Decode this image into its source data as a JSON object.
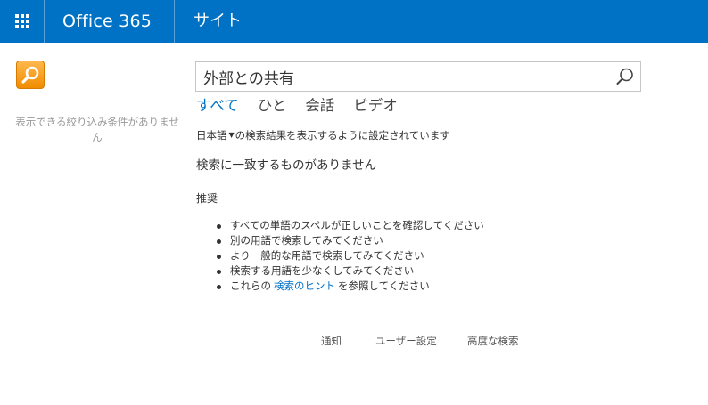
{
  "suite_bar": {
    "brand": "Office 365",
    "site_link": "サイト",
    "background_color": "#0072c6",
    "app_launcher_icon": "waffle-grid-icon"
  },
  "left_rail": {
    "site_logo_icon": "search-magnifier-icon",
    "refiners_empty_text": "表示できる絞り込み条件がありません"
  },
  "search": {
    "query": "外部との共有",
    "button_icon": "search-icon"
  },
  "verticals": [
    {
      "label": "すべて",
      "selected": true
    },
    {
      "label": "ひと",
      "selected": false
    },
    {
      "label": "会話",
      "selected": false
    },
    {
      "label": "ビデオ",
      "selected": false
    }
  ],
  "language": {
    "language_name": "日本語",
    "suffix": "の検索結果を表示するように設定されています"
  },
  "results": {
    "no_results_message": "検索に一致するものがありません",
    "suggestions_heading": "推奨",
    "suggestions": [
      "すべての単語のスペルが正しいことを確認してください",
      "別の用語で検索してみてください",
      "より一般的な用語で検索してみてください",
      "検索する用語を少なくしてみてください"
    ],
    "tips_prefix": "これらの",
    "tips_link": "検索のヒント",
    "tips_suffix": "を参照してください"
  },
  "footer": {
    "alert": "通知",
    "preferences": "ユーザー設定",
    "advanced_search": "高度な検索"
  },
  "colors": {
    "accent": "#0072c6",
    "logo_orange": "#f08c00"
  }
}
